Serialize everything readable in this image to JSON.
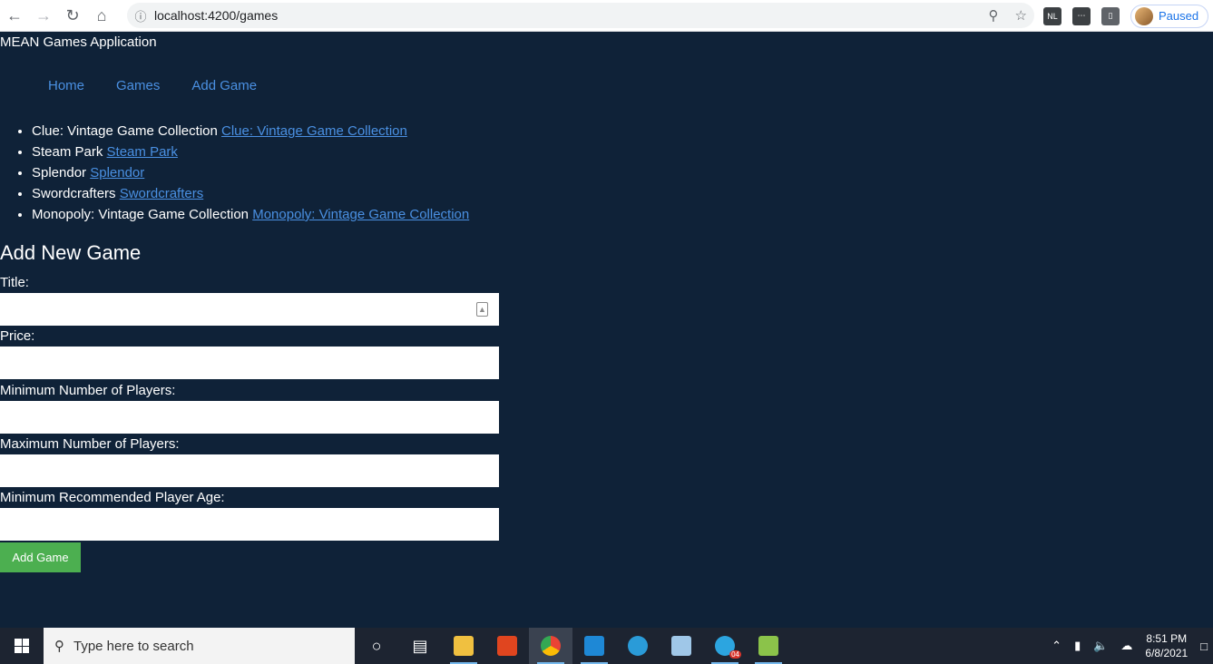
{
  "browser": {
    "url": "localhost:4200/games",
    "profile_status": "Paused",
    "extension_badge": "NL"
  },
  "app": {
    "title": "MEAN Games Application"
  },
  "nav": {
    "items": [
      {
        "label": "Home"
      },
      {
        "label": "Games"
      },
      {
        "label": "Add Game"
      }
    ]
  },
  "games": [
    {
      "title": "Clue: Vintage Game Collection",
      "link": "Clue: Vintage Game Collection"
    },
    {
      "title": "Steam Park",
      "link": "Steam Park"
    },
    {
      "title": "Splendor",
      "link": "Splendor"
    },
    {
      "title": "Swordcrafters",
      "link": "Swordcrafters"
    },
    {
      "title": "Monopoly: Vintage Game Collection",
      "link": "Monopoly: Vintage Game Collection"
    }
  ],
  "form": {
    "heading": "Add New Game",
    "fields": [
      {
        "label": "Title:",
        "value": ""
      },
      {
        "label": "Price:",
        "value": ""
      },
      {
        "label": "Minimum Number of Players:",
        "value": ""
      },
      {
        "label": "Maximum Number of Players:",
        "value": ""
      },
      {
        "label": "Minimum Recommended Player Age:",
        "value": ""
      }
    ],
    "submit_label": "Add Game"
  },
  "taskbar": {
    "search_placeholder": "Type here to search",
    "telegram_badge": "04",
    "time": "8:51 PM",
    "date": "6/8/2021"
  },
  "colors": {
    "page_bg": "#0f2238",
    "link": "#4a90e2",
    "submit_bg": "#4caf50"
  }
}
